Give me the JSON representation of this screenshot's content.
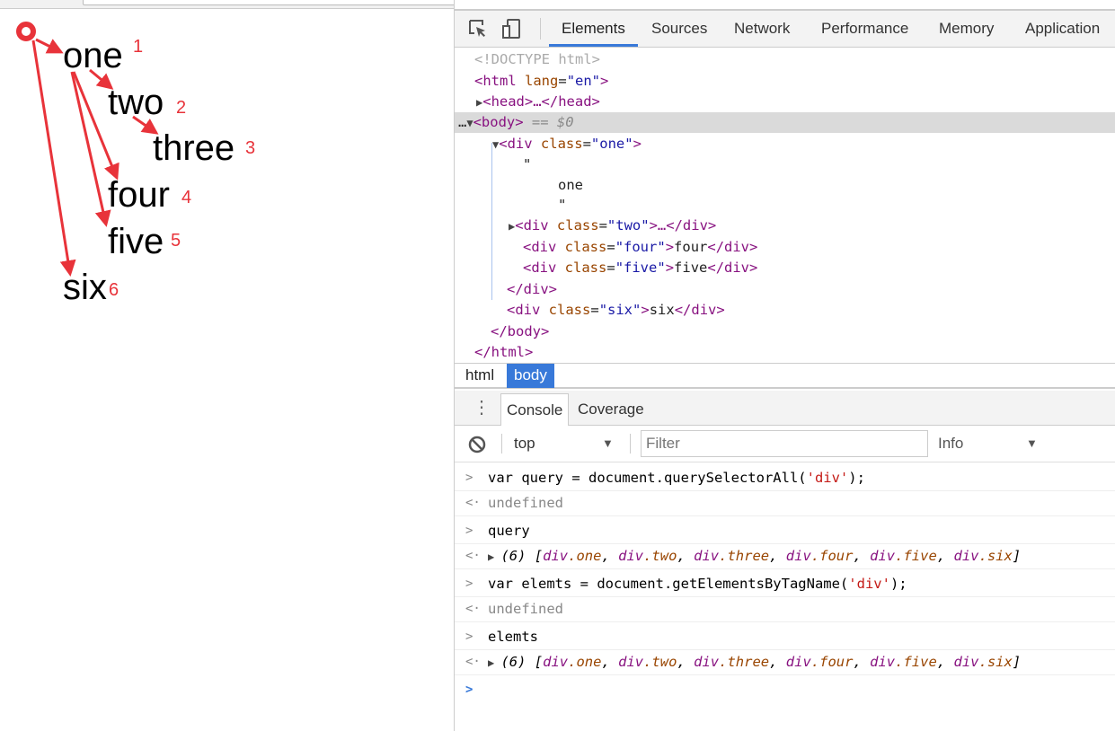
{
  "page": {
    "words": [
      {
        "text": "one",
        "n": "1"
      },
      {
        "text": "two",
        "n": "2"
      },
      {
        "text": "three",
        "n": "3"
      },
      {
        "text": "four",
        "n": "4"
      },
      {
        "text": "five",
        "n": "5"
      },
      {
        "text": "six",
        "n": "6"
      }
    ],
    "annotation_color": "#e8333a"
  },
  "devtools": {
    "tabs": [
      "Elements",
      "Sources",
      "Network",
      "Performance",
      "Memory",
      "Application"
    ],
    "active_tab": "Elements",
    "tree": {
      "doctype": "<!DOCTYPE html>",
      "html_open": "<html",
      "lang_attr": "lang",
      "lang_val": "\"en\"",
      "head": "<head>…</head>",
      "body": "<body>",
      "body_marker": "== $0",
      "div_one_tag": "<div",
      "class_attr": "class",
      "one_val": "\"one\"",
      "quote": "\"",
      "one_text": "one",
      "two_val": "\"two\"",
      "four_val": "\"four\"",
      "five_val": "\"five\"",
      "six_val": "\"six\"",
      "two_rest": ">…</div>",
      "four_text": "four",
      "five_text": "five",
      "six_text": "six",
      "div_close": "</div>",
      "body_close": "</body>",
      "html_close": "</html>"
    },
    "breadcrumbs": [
      "html",
      "body"
    ],
    "drawer_tabs": [
      "Console",
      "Coverage"
    ],
    "console_toolbar": {
      "context": "top",
      "filter_placeholder": "Filter",
      "level": "Info"
    },
    "console": [
      {
        "type": "input",
        "code_a": "var query = document.querySelectorAll(",
        "code_s": "'div'",
        "code_b": ");"
      },
      {
        "type": "output",
        "text": "undefined"
      },
      {
        "type": "input",
        "code_a": "query"
      },
      {
        "type": "array",
        "count": "(6)",
        "items": [
          "one",
          "two",
          "three",
          "four",
          "five",
          "six"
        ]
      },
      {
        "type": "input",
        "code_a": "var elemts = document.getElementsByTagName(",
        "code_s": "'div'",
        "code_b": ");"
      },
      {
        "type": "output",
        "text": "undefined"
      },
      {
        "type": "input",
        "code_a": "elemts"
      },
      {
        "type": "array",
        "count": "(6)",
        "items": [
          "one",
          "two",
          "three",
          "four",
          "five",
          "six"
        ]
      }
    ]
  }
}
